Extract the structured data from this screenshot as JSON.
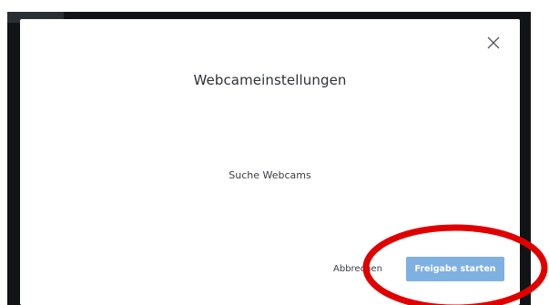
{
  "dialog": {
    "title": "Webcameinstellungen",
    "status": "Suche Webcams",
    "cancel_label": "Abbrechen",
    "start_label": "Freigabe starten",
    "close_icon": "close-icon"
  },
  "colors": {
    "primary_button": "#7fb0e2",
    "annotation_circle": "#e00000",
    "backdrop": "#111417"
  }
}
